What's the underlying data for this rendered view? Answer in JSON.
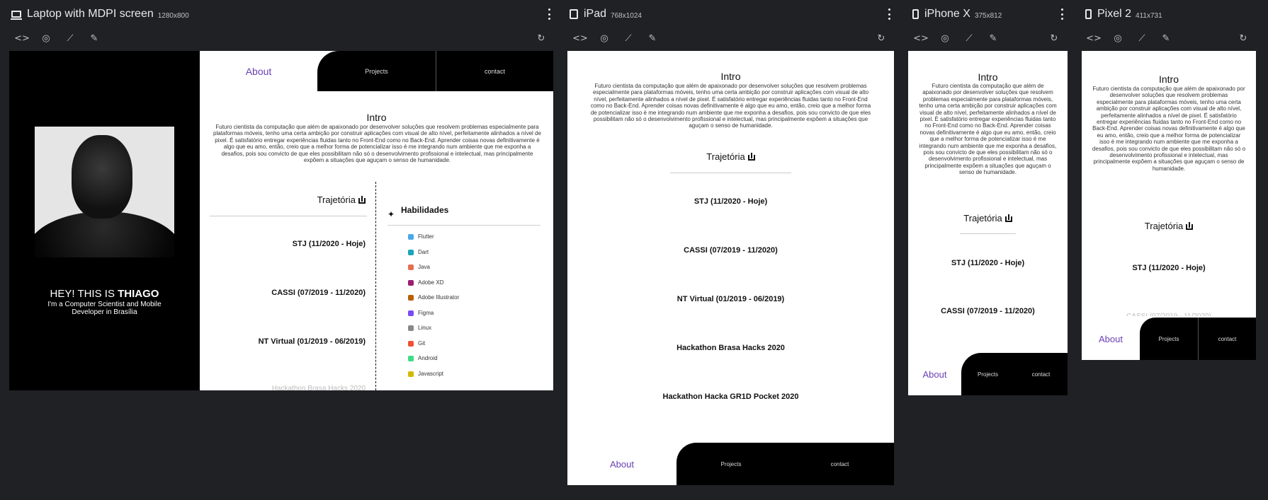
{
  "devices": {
    "laptop": {
      "name": "Laptop with MDPI screen",
      "size": "1280x800"
    },
    "ipad": {
      "name": "iPad",
      "size": "768x1024"
    },
    "iphone": {
      "name": "iPhone X",
      "size": "375x812"
    },
    "pixel": {
      "name": "Pixel 2",
      "size": "411x731"
    }
  },
  "toolbar_icons": [
    "code-icon",
    "camera-icon",
    "flip-icon",
    "edit-icon",
    "rotate-icon"
  ],
  "site": {
    "nav": {
      "about": "About",
      "projects": "Projects",
      "contact": "contact"
    },
    "hero": {
      "title_prefix": "HEY! THIS IS ",
      "title_name": "THIAGO",
      "subtitle": "I'm a Computer Scientist and Mobile Developer in Brasília"
    },
    "intro": {
      "title": "Intro",
      "text": "Futuro cientista da computação que além de apaixonado por desenvolver soluções que resolvem problemas especialmente para plataformas móveis, tenho uma certa ambição por construir aplicações com visual de alto nível, perfeitamente alinhados a nível de pixel. É satisfatório entregar experiências fluidas tanto no Front-End como no Back-End. Aprender coisas novas definitivamente é algo que eu amo, então, creio que a melhor forma de potencializar isso é me integrando num ambiente que me exponha a desafios, pois sou convicto de que eles possibilitam não só o desenvolvimento profissional e intelectual, mas principalmente expõem a situações que aguçam o senso de humanidade."
    },
    "trajetoria": {
      "title": "Trajetória",
      "items": [
        "STJ (11/2020 - Hoje)",
        "CASSI (07/2019 - 11/2020)",
        "NT Virtual (01/2019 - 06/2019)",
        "Hackathon Brasa Hacks 2020",
        "Hackathon Hacka GR1D Pocket 2020"
      ]
    },
    "habilidades": {
      "title": "Habilidades",
      "items": [
        {
          "name": "Flutter",
          "color": "#4aa8e8"
        },
        {
          "name": "Dart",
          "color": "#1aa6b8"
        },
        {
          "name": "Java",
          "color": "#e76f51"
        },
        {
          "name": "Adobe XD",
          "color": "#9b1e70"
        },
        {
          "name": "Adobe Illustrator",
          "color": "#b85f00"
        },
        {
          "name": "Figma",
          "color": "#7a4cf0"
        },
        {
          "name": "Linux",
          "color": "#888888"
        },
        {
          "name": "Git",
          "color": "#f05033"
        },
        {
          "name": "Android",
          "color": "#3ddc84"
        },
        {
          "name": "Javascript",
          "color": "#d4b800"
        }
      ]
    }
  },
  "colors": {
    "accent": "#6a3fb5",
    "app_bg": "#202124",
    "nav_dark": "#000000"
  }
}
